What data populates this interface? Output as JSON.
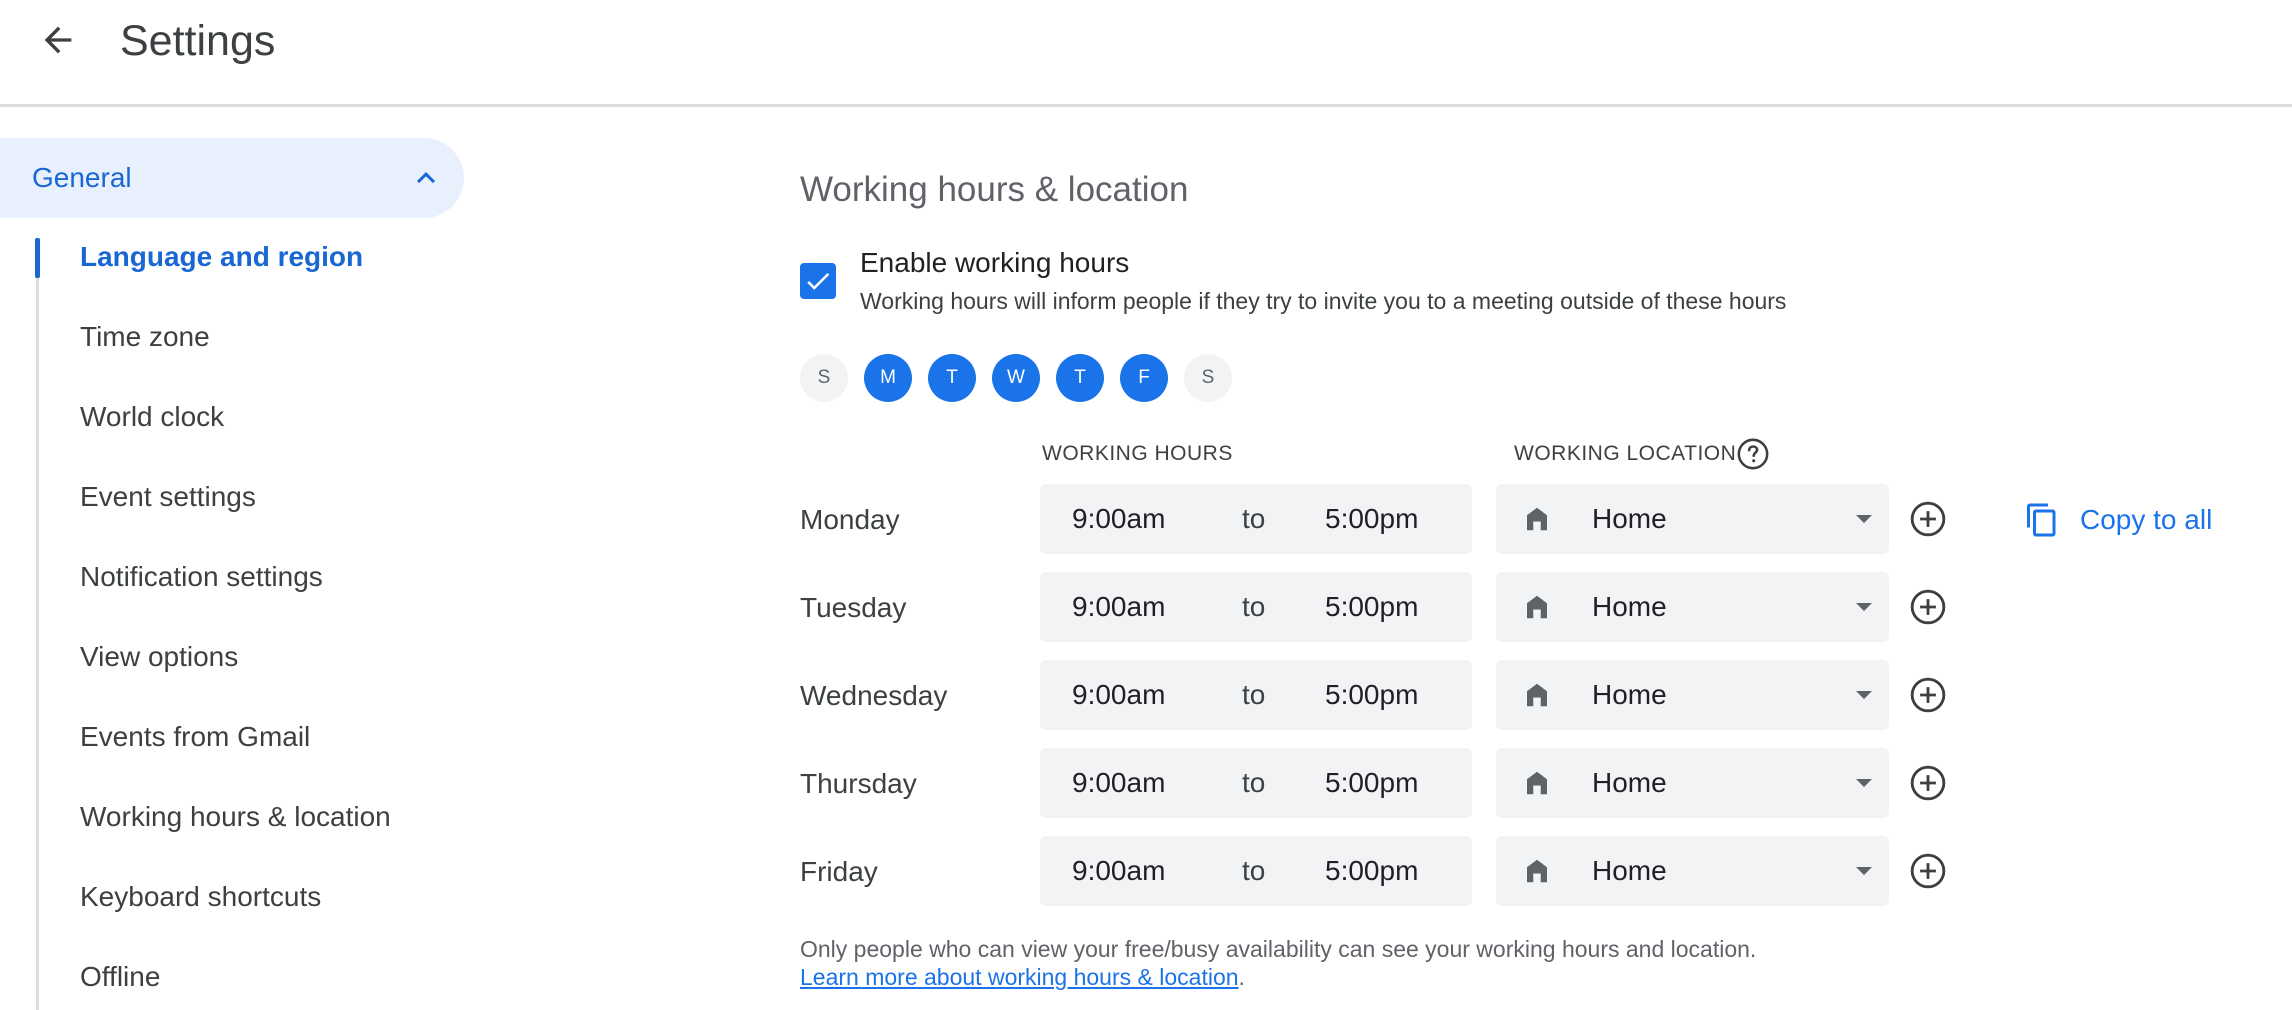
{
  "header": {
    "title": "Settings",
    "back_icon": "arrow-back-icon"
  },
  "sidebar": {
    "group_label": "General",
    "group_expanded": true,
    "active_item": "Language and region",
    "items": [
      {
        "label": "Language and region"
      },
      {
        "label": "Time zone"
      },
      {
        "label": "World clock"
      },
      {
        "label": "Event settings"
      },
      {
        "label": "Notification settings"
      },
      {
        "label": "View options"
      },
      {
        "label": "Events from Gmail"
      },
      {
        "label": "Working hours & location"
      },
      {
        "label": "Keyboard shortcuts"
      },
      {
        "label": "Offline"
      }
    ]
  },
  "main": {
    "section_title": "Working hours & location",
    "enable": {
      "checked": true,
      "label": "Enable working hours",
      "description": "Working hours will inform people if they try to invite you to a meeting outside of these hours"
    },
    "weekdays": [
      {
        "letter": "S",
        "selected": false
      },
      {
        "letter": "M",
        "selected": true
      },
      {
        "letter": "T",
        "selected": true
      },
      {
        "letter": "W",
        "selected": true
      },
      {
        "letter": "T",
        "selected": true
      },
      {
        "letter": "F",
        "selected": true
      },
      {
        "letter": "S",
        "selected": false
      }
    ],
    "columns": {
      "hours": "WORKING HOURS",
      "location": "WORKING LOCATION"
    },
    "rows": [
      {
        "day": "Monday",
        "start": "9:00am",
        "sep": "to",
        "end": "5:00pm",
        "location": "Home"
      },
      {
        "day": "Tuesday",
        "start": "9:00am",
        "sep": "to",
        "end": "5:00pm",
        "location": "Home"
      },
      {
        "day": "Wednesday",
        "start": "9:00am",
        "sep": "to",
        "end": "5:00pm",
        "location": "Home"
      },
      {
        "day": "Thursday",
        "start": "9:00am",
        "sep": "to",
        "end": "5:00pm",
        "location": "Home"
      },
      {
        "day": "Friday",
        "start": "9:00am",
        "sep": "to",
        "end": "5:00pm",
        "location": "Home"
      }
    ],
    "copy_all_label": "Copy to all",
    "footnote": "Only people who can view your free/busy availability can see your working hours and location.",
    "learn_more_label": "Learn more about working hours & location",
    "learn_more_suffix": "."
  },
  "colors": {
    "accent": "#1a73e8",
    "accent_dark": "#1967d2",
    "active_bg": "#e8f0fe",
    "field_bg": "#f1f3f4"
  },
  "icons": [
    "arrow-back-icon",
    "chevron-up-icon",
    "check-icon",
    "help-icon",
    "home-icon",
    "dropdown-caret-icon",
    "add-circle-icon",
    "copy-icon"
  ]
}
